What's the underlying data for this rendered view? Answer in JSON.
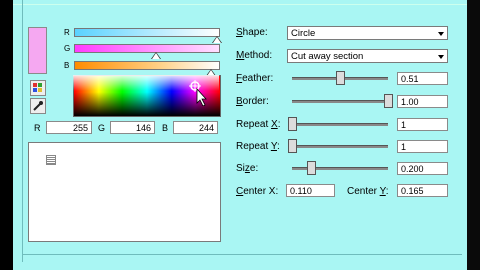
{
  "left": {
    "sliders": [
      {
        "label": "R",
        "level": 1.0,
        "gradient": [
          "#5ad2ff",
          "#ffffff"
        ]
      },
      {
        "label": "G",
        "level": 0.57,
        "gradient": [
          "#ff3cff",
          "#ffe0ff"
        ]
      },
      {
        "label": "B",
        "level": 0.96,
        "gradient": [
          "#ff8c00",
          "#ffffff"
        ]
      }
    ],
    "preview_color": "#f5a8f1",
    "tools": [
      {
        "name": "palette-icon"
      },
      {
        "name": "eyedropper-icon"
      }
    ],
    "rgb_fields": [
      {
        "label": "R",
        "value": "255"
      },
      {
        "label": "G",
        "value": "146"
      },
      {
        "label": "B",
        "value": "244"
      }
    ]
  },
  "right": {
    "shape": {
      "label": "Shape:",
      "value": "Circle"
    },
    "method": {
      "label": "Method:",
      "value": "Cut away section"
    },
    "feather": {
      "label": "Feather:",
      "value": "0.51",
      "level": 0.5
    },
    "border": {
      "label": "Border:",
      "value": "1.00",
      "level": 1.0
    },
    "repeat_x": {
      "label": "Repeat X:",
      "value": "1",
      "level": 0.0
    },
    "repeat_y": {
      "label": "Repeat Y:",
      "value": "1",
      "level": 0.0
    },
    "size": {
      "label": "Size:",
      "value": "0.200",
      "level": 0.2
    },
    "center_x": {
      "label": "Center X:",
      "value": "0.110"
    },
    "center_y": {
      "label": "Center Y:",
      "value": "0.165"
    }
  }
}
